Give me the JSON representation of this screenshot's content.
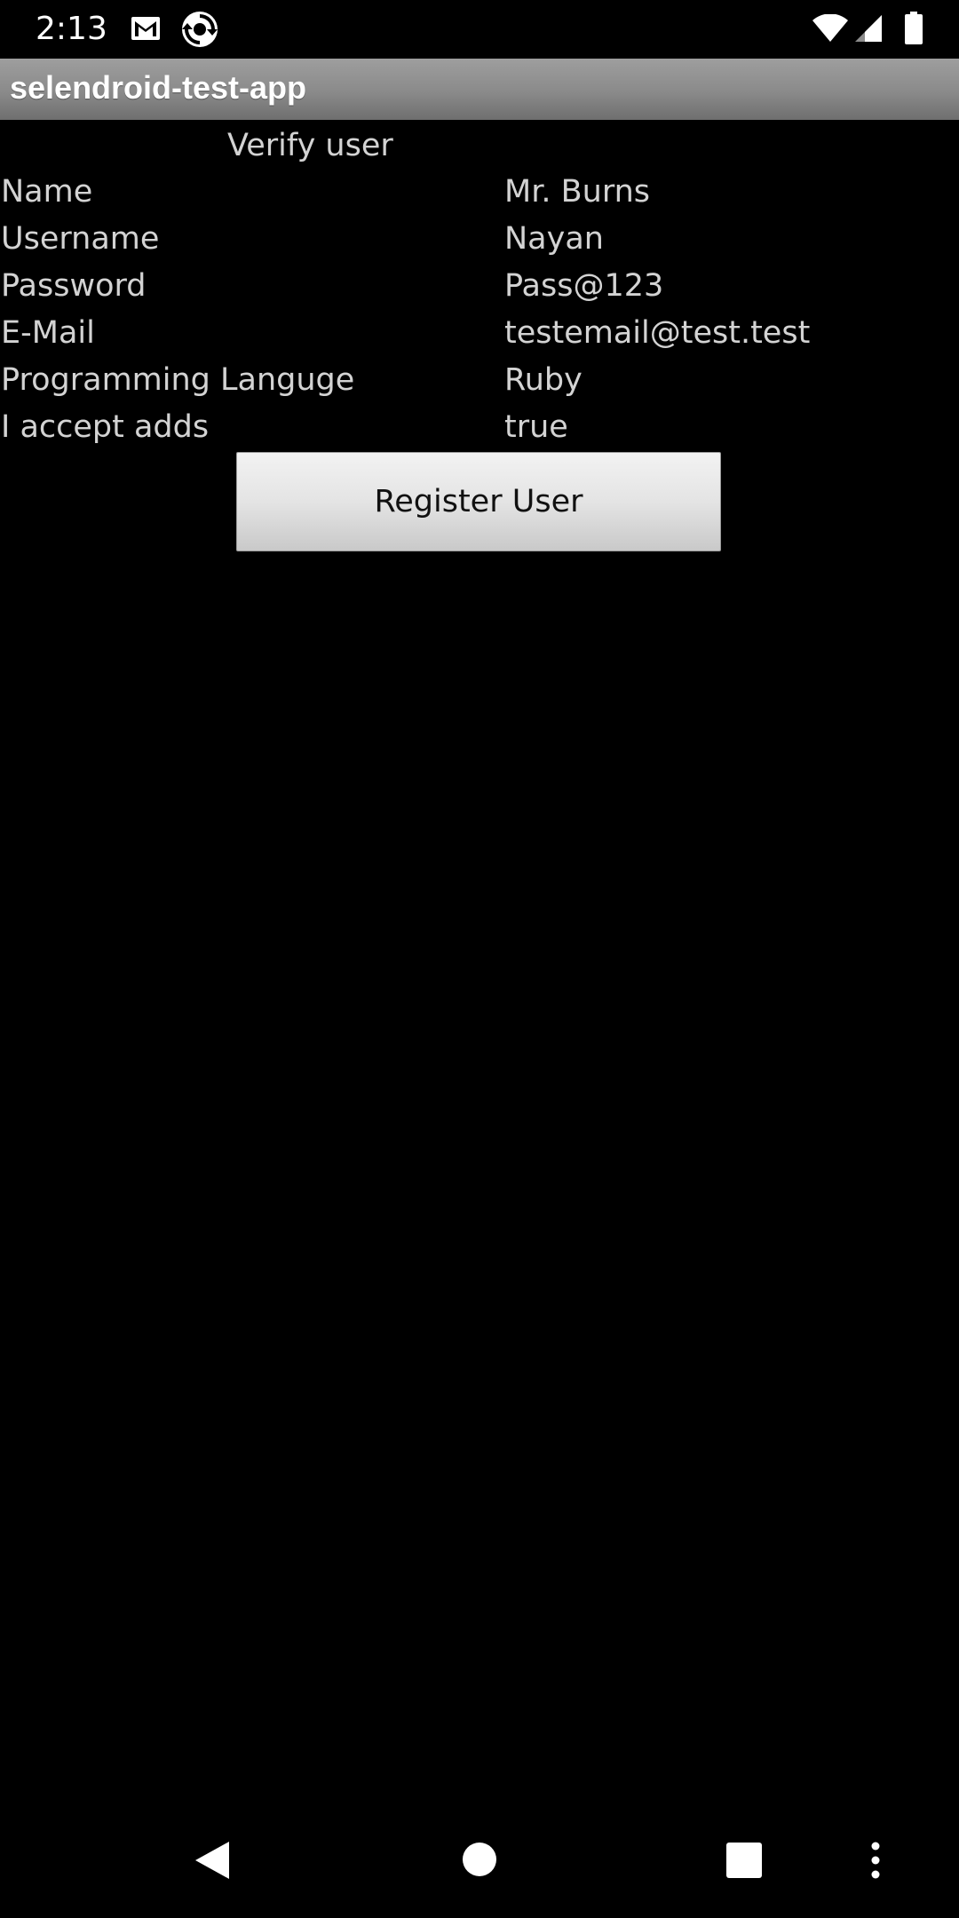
{
  "status_bar": {
    "time": "2:13",
    "icons": [
      "gmail-icon",
      "sync-app-icon",
      "wifi-icon",
      "cell-signal-icon",
      "battery-icon"
    ]
  },
  "app_bar": {
    "title": "selendroid-test-app"
  },
  "verify": {
    "heading": "Verify user",
    "rows": [
      {
        "label": "Name",
        "value": "Mr. Burns"
      },
      {
        "label": "Username",
        "value": "Nayan"
      },
      {
        "label": "Password",
        "value": "Pass@123"
      },
      {
        "label": "E-Mail",
        "value": "testemail@test.test"
      },
      {
        "label": "Programming Languge",
        "value": "Ruby"
      },
      {
        "label": "I accept adds",
        "value": "true"
      }
    ],
    "register_button_label": "Register User"
  },
  "nav_bar": {
    "icons": [
      "back-icon",
      "home-icon",
      "recents-icon",
      "overflow-menu-icon"
    ]
  },
  "colors": {
    "background": "#000000",
    "text": "#d3d3d3",
    "title_bar": "#8a8a8a",
    "button": "#e4e4e4"
  }
}
